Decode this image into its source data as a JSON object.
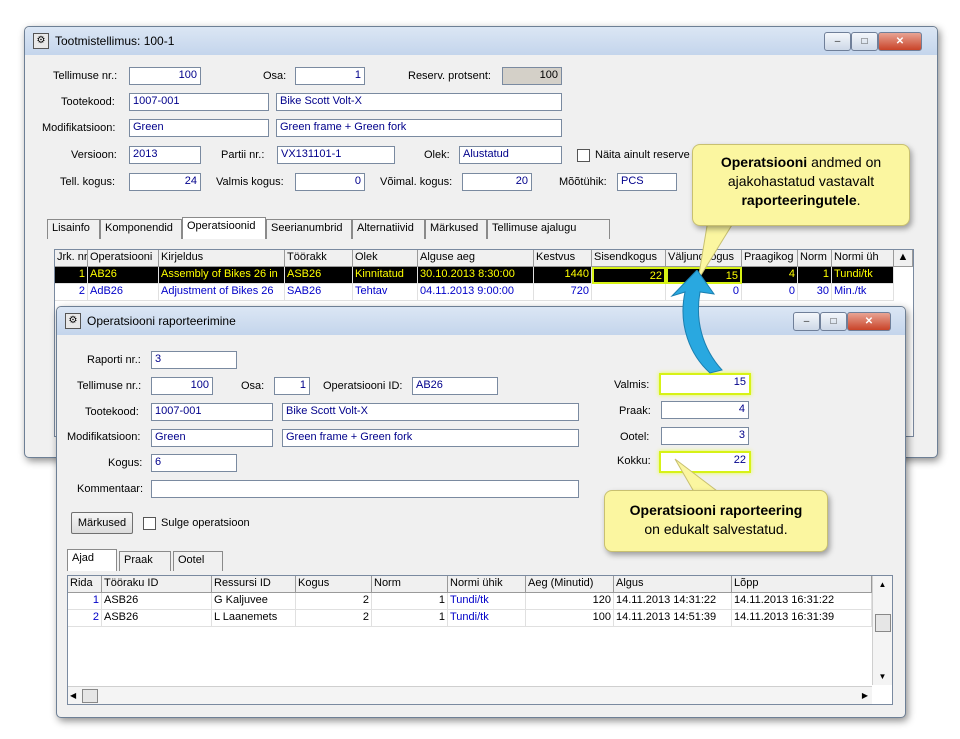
{
  "main_window": {
    "title": "Tootmistellimus: 100-1",
    "labels": {
      "order_no": "Tellimuse nr.:",
      "part": "Osa:",
      "reserve_pct": "Reserv. protsent:",
      "product_code": "Tootekood:",
      "modification": "Modifikatsioon:",
      "version": "Versioon:",
      "batch_no": "Partii nr.:",
      "state": "Olek:",
      "show_reserved": "Näita ainult reserve",
      "order_qty": "Tell. kogus:",
      "done_qty": "Valmis kogus:",
      "possible_qty": "Võimal. kogus:",
      "unit": "Mõõtühik:"
    },
    "values": {
      "order_no": "100",
      "part": "1",
      "reserve_pct": "100",
      "product_code": "1007-001",
      "product_name": "Bike Scott Volt-X",
      "modification": "Green",
      "modification_desc": "Green frame + Green fork",
      "version": "2013",
      "batch_no": "VX131101-1",
      "state": "Alustatud",
      "order_qty": "24",
      "done_qty": "0",
      "possible_qty": "20",
      "unit": "PCS"
    },
    "tabs": [
      "Lisainfo",
      "Komponendid",
      "Operatsioonid",
      "Seerianumbrid",
      "Alternatiivid",
      "Märkused",
      "Tellimuse ajalugu"
    ],
    "grid": {
      "columns": [
        "Jrk. nr",
        "Operatsiooni",
        "Kirjeldus",
        "Töörakk",
        "Olek",
        "Alguse aeg",
        "Kestvus",
        "Sisendkogus",
        "Väljundkogus",
        "Praagikog",
        "Norm",
        "Normi üh"
      ],
      "rows": [
        [
          "1",
          "AB26",
          "Assembly of Bikes 26 in",
          "ASB26",
          "Kinnitatud",
          "30.10.2013 8:30:00",
          "1440",
          "22",
          "15",
          "4",
          "1",
          "Tundi/tk"
        ],
        [
          "2",
          "AdB26",
          "Adjustment of Bikes 26",
          "SAB26",
          "Tehtav",
          "04.11.2013 9:00:00",
          "720",
          "",
          "0",
          "0",
          "30",
          "Min./tk"
        ]
      ]
    }
  },
  "callout_top": {
    "bold1": "Operatsiooni",
    "text1": " andmed on",
    "text2": "ajakohastatud vastavalt",
    "bold2": "raporteeringutele",
    "text3": "."
  },
  "callout_bottom": {
    "bold": "Operatsiooni raporteering",
    "text": "on edukalt salvestatud."
  },
  "report_window": {
    "title": "Operatsiooni raporteerimine",
    "labels": {
      "report_no": "Raporti nr.:",
      "order_no": "Tellimuse nr.:",
      "part": "Osa:",
      "operation_id": "Operatsiooni ID:",
      "product_code": "Tootekood:",
      "modification": "Modifikatsioon:",
      "qty": "Kogus:",
      "comment": "Kommentaar:",
      "done": "Valmis:",
      "scrap": "Praak:",
      "waiting": "Ootel:",
      "total": "Kokku:",
      "close_operation": "Sulge operatsioon"
    },
    "values": {
      "report_no": "3",
      "order_no": "100",
      "part": "1",
      "operation_id": "AB26",
      "product_code": "1007-001",
      "product_name": "Bike Scott Volt-X",
      "modification": "Green",
      "modification_desc": "Green frame + Green fork",
      "qty": "6",
      "comment": "",
      "done": "15",
      "scrap": "4",
      "waiting": "3",
      "total": "22"
    },
    "notes_button": "Märkused",
    "tabs": [
      "Ajad",
      "Praak",
      "Ootel"
    ],
    "grid": {
      "columns": [
        "Rida",
        "Tööraku ID",
        "Ressursi ID",
        "Kogus",
        "Norm",
        "Normi ühik",
        "Aeg (Minutid)",
        "Algus",
        "Lõpp"
      ],
      "rows": [
        [
          "1",
          "ASB26",
          "G Kaljuvee",
          "2",
          "1",
          "Tundi/tk",
          "120",
          "14.11.2013 14:31:22",
          "14.11.2013 16:31:22"
        ],
        [
          "2",
          "ASB26",
          "L Laanemets",
          "2",
          "1",
          "Tundi/tk",
          "100",
          "14.11.2013 14:51:39",
          "14.11.2013 16:31:39"
        ]
      ]
    }
  },
  "colors": {
    "highlight": "#d7f216",
    "callout_bg": "#fbf6a0",
    "arrow": "#29a8e0",
    "selected_row_bg": "#000000",
    "selected_row_text": "#ffff00"
  }
}
